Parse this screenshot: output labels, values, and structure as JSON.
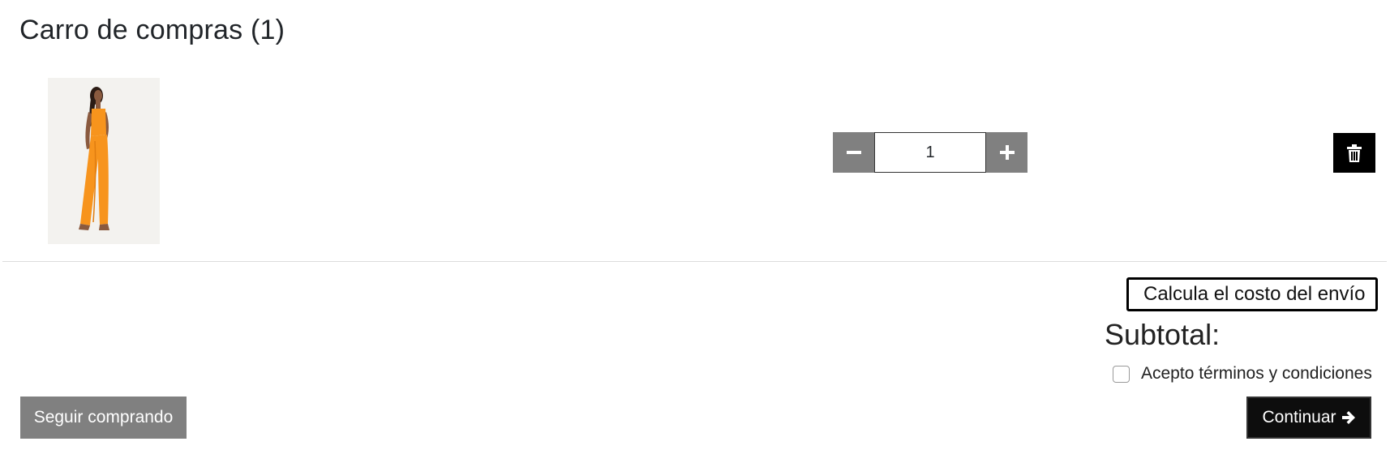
{
  "cart": {
    "title": "Carro de compras (1)"
  },
  "item": {
    "image_alt": "Jumpsuit naranja",
    "quantity": "1",
    "decrease_icon": "minus-icon",
    "increase_icon": "plus-icon",
    "delete_icon": "trash-icon"
  },
  "summary": {
    "shipping_label": "Calcula el costo del envío",
    "subtotal_label": "Subtotal:",
    "terms_label": "Acepto términos y condiciones",
    "terms_checked": false
  },
  "actions": {
    "continue_shopping_label": "Seguir comprando",
    "continue_label": "Continuar",
    "continue_icon": "arrow-right-icon"
  },
  "colors": {
    "gray_button": "#808080",
    "dark_button": "#0d0d0d",
    "product_orange": "#f7941d"
  }
}
